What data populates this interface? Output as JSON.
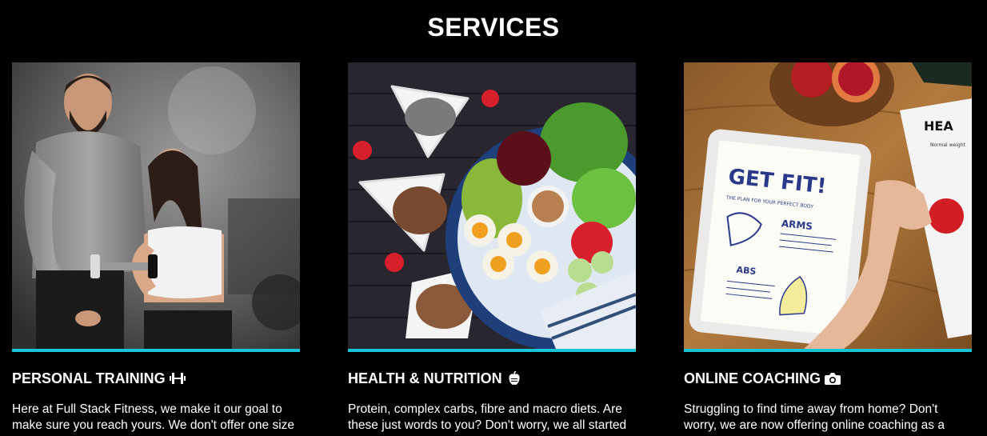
{
  "section": {
    "title": "SERVICES"
  },
  "colors": {
    "background": "#000000",
    "accent": "#17c6d6",
    "text": "#ffffff"
  },
  "cards": [
    {
      "heading": "PERSONAL TRAINING",
      "icon": "dumbbell-icon",
      "image": "personal-trainer-photo",
      "text": "Here at Full Stack Fitness, we make it our goal to make sure you reach yours. We don't offer one size"
    },
    {
      "heading": "HEALTH & NUTRITION",
      "icon": "apple-icon",
      "image": "healthy-food-photo",
      "text": "Protein, complex carbs, fibre and macro diets. Are these just words to you? Don't worry, we all started"
    },
    {
      "heading": "ONLINE COACHING",
      "icon": "camera-icon",
      "image": "tablet-get-fit-photo",
      "text": "Struggling to find time away from home? Don't worry, we are now offering online coaching as a"
    }
  ],
  "tablet_image": {
    "headline": "GET FIT!",
    "tagline": "THE PLAN FOR YOUR PERFECT BODY",
    "arms": "ARMS",
    "abs": "ABS",
    "paper_title": "HEA",
    "paper_sub": "Normal weight"
  }
}
